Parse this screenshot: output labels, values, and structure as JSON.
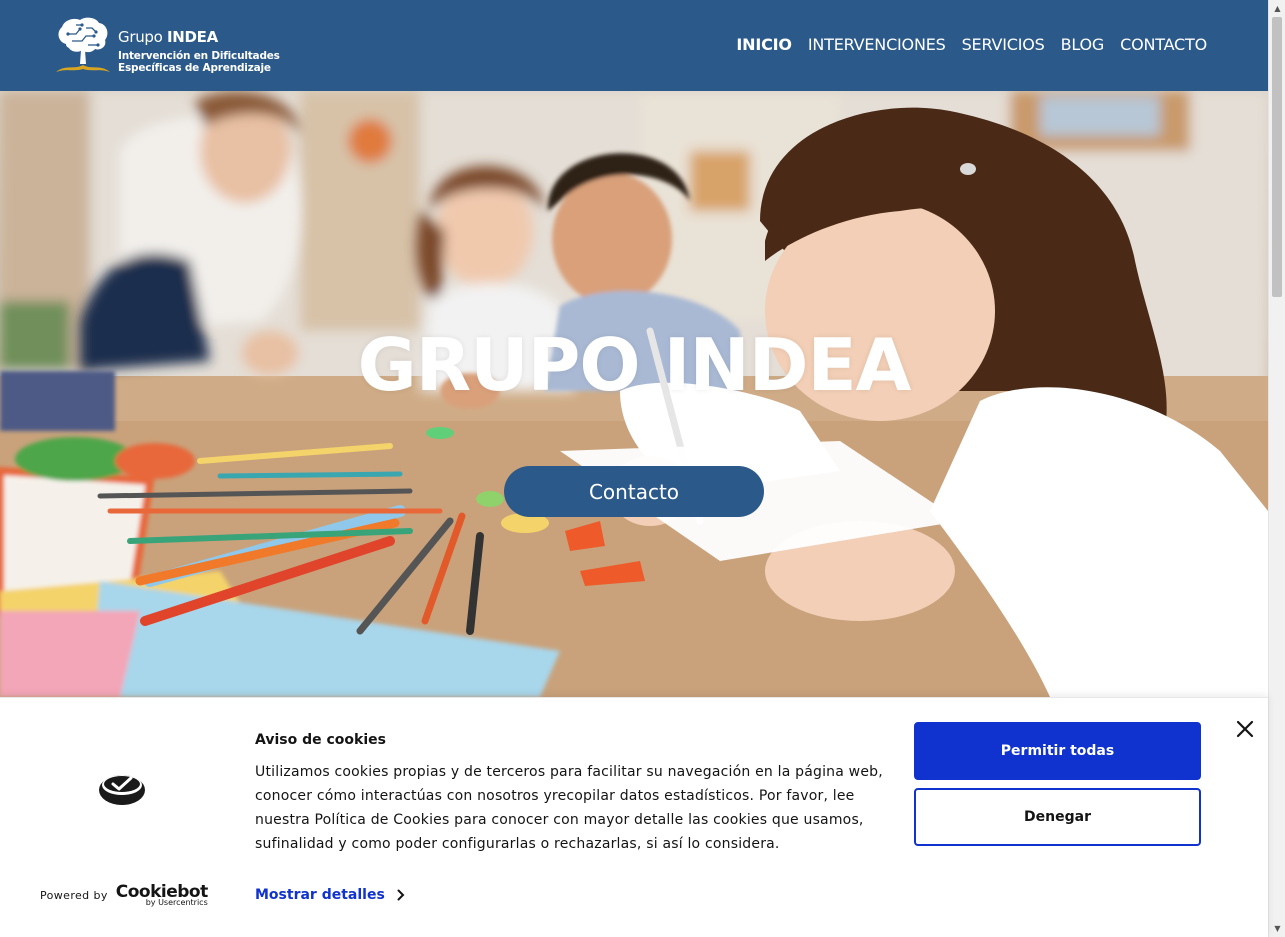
{
  "header": {
    "logo": {
      "brand_light": "Grupo",
      "brand_bold": "INDEA",
      "subtitle_line1": "Intervención en Dificultades",
      "subtitle_line2": "Específicas de Aprendizaje"
    },
    "nav": [
      {
        "label": "INICIO",
        "active": true
      },
      {
        "label": "INTERVENCIONES",
        "active": false
      },
      {
        "label": "SERVICIOS",
        "active": false
      },
      {
        "label": "BLOG",
        "active": false
      },
      {
        "label": "CONTACTO",
        "active": false
      }
    ]
  },
  "hero": {
    "title": "GRUPO INDEA",
    "button_label": "Contacto"
  },
  "cookie_banner": {
    "title": "Aviso de cookies",
    "body": "Utilizamos cookies propias y de terceros para facilitar su navegación en la página web, conocer cómo interactúas con nosotros yrecopilar datos estadísticos. Por favor, lee nuestra Política de Cookies para conocer con mayor detalle las cookies que usamos, sufinalidad y como poder configurarlas o rechazarlas, si así lo considera.",
    "details_link": "Mostrar detalles",
    "allow_button": "Permitir todas",
    "deny_button": "Denegar",
    "powered_by": "Powered by",
    "provider": "Cookiebot",
    "provider_sub": "by Usercentrics"
  },
  "colors": {
    "header_bg": "#2b5a8a",
    "cookie_accent": "#1032cf",
    "logo_gold": "#d9a521"
  },
  "icons": {
    "logo_mark": "brain-tree-icon",
    "cookie_logo": "cookiebot-check-icon",
    "close": "close-icon",
    "details_chevron": "chevron-right-icon"
  }
}
